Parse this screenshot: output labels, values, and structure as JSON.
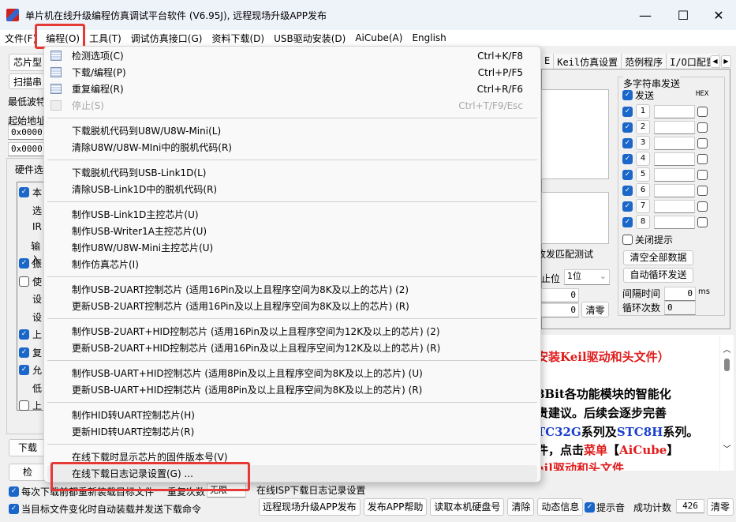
{
  "window": {
    "title": "单片机在线升级编程仿真调试平台软件 (V6.95J), 远程现场升级APP发布",
    "minimize": "—",
    "maximize": "☐",
    "close": "✕"
  },
  "menubar": [
    "文件(F)",
    "编程(O)",
    "工具(T)",
    "调试仿真接口(G)",
    "资料下载(D)",
    "USB驱动安装(D)",
    "AiCube(A)",
    "English"
  ],
  "left": {
    "chip_type": "芯片型",
    "scan": "扫描串",
    "min_baud": "最低波特",
    "start_addr": "起始地址",
    "addr1": "0x0000",
    "addr2": "0x0000",
    "hw_group": "硬件选",
    "opts": [
      {
        "label": "本",
        "checked": true
      },
      {
        "label": "选",
        "checked": null
      },
      {
        "label": "IR",
        "checked": null
      },
      {
        "label": "输入",
        "checked": null
      },
      {
        "label": "振",
        "checked": true
      },
      {
        "label": "使",
        "checked": false
      },
      {
        "label": "设",
        "checked": null
      },
      {
        "label": "设",
        "checked": null
      },
      {
        "label": "上",
        "checked": true
      },
      {
        "label": "复",
        "checked": true
      },
      {
        "label": "允",
        "checked": true
      },
      {
        "label": "低",
        "checked": null
      },
      {
        "label": "上",
        "checked": false
      }
    ],
    "download_btn": "下载",
    "check_btn": "检"
  },
  "tabs": [
    "E",
    "Keil仿真设置",
    "范例程序",
    "I/O口配置"
  ],
  "multi": {
    "title": "多字符串发送",
    "send": "发送",
    "hex": "HEX",
    "rows": [
      "1",
      "2",
      "3",
      "4",
      "5",
      "6",
      "7",
      "8"
    ],
    "close_tip": "关闭提示",
    "clear_all": "清空全部数据",
    "auto_loop": "自动循环发送",
    "interval_label": "间隔时间",
    "interval": "0",
    "interval_unit": "ms",
    "loop_label": "循环次数",
    "loop": "0"
  },
  "serial": {
    "match_test": "收发匹配测试",
    "stop_bits_label": "止位",
    "stop_bits": "1位",
    "count1": "0",
    "count2": "0",
    "clear": "清零"
  },
  "doc_lines": [
    [
      {
        "t": "安装Keil驱动和头文件）",
        "c": "red"
      }
    ],
    [
      {
        "t": "8Bit各功能模块的智能化",
        "c": ""
      }
    ],
    [
      {
        "t": "贵建议。后续会逐步完善",
        "c": ""
      }
    ],
    [
      {
        "t": "TC32G",
        "c": "blue"
      },
      {
        "t": "系列及",
        "c": ""
      },
      {
        "t": "STC8H",
        "c": "blue"
      },
      {
        "t": "系列。",
        "c": ""
      }
    ],
    [
      {
        "t": "件，点击",
        "c": ""
      },
      {
        "t": "菜单",
        "c": "red"
      },
      {
        "t": "【",
        "c": ""
      },
      {
        "t": "AiCube",
        "c": "red"
      },
      {
        "t": "】",
        "c": ""
      }
    ],
    [
      {
        "t": "eil驱动和头文件",
        "c": "red"
      }
    ]
  ],
  "menu": [
    {
      "label": "检测选项(C)",
      "shortcut": "Ctrl+K/F8",
      "icon": "check-options"
    },
    {
      "label": "下载/编程(P)",
      "shortcut": "Ctrl+P/F5",
      "icon": "download"
    },
    {
      "label": "重复编程(R)",
      "shortcut": "Ctrl+R/F6",
      "icon": "repeat-program"
    },
    {
      "label": "停止(S)",
      "shortcut": "Ctrl+T/F9/Esc",
      "icon": "stop",
      "disabled": true
    },
    {
      "sep": true
    },
    {
      "label": "下载脱机代码到U8W/U8W-Mini(L)"
    },
    {
      "label": "清除U8W/U8W-MIni中的脱机代码(R)"
    },
    {
      "sep": true
    },
    {
      "label": "下载脱机代码到USB-Link1D(L)"
    },
    {
      "label": "清除USB-Link1D中的脱机代码(R)"
    },
    {
      "sep": true
    },
    {
      "label": "制作USB-Link1D主控芯片(U)"
    },
    {
      "label": "制作USB-Writer1A主控芯片(U)"
    },
    {
      "label": "制作U8W/U8W-Mini主控芯片(U)"
    },
    {
      "label": "制作仿真芯片(I)"
    },
    {
      "sep": true
    },
    {
      "label": "制作USB-2UART控制芯片 (适用16Pin及以上且程序空间为8K及以上的芯片) (2)"
    },
    {
      "label": "更新USB-2UART控制芯片 (适用16Pin及以上且程序空间为8K及以上的芯片) (R)"
    },
    {
      "sep": true
    },
    {
      "label": "制作USB-2UART+HID控制芯片 (适用16Pin及以上且程序空间为12K及以上的芯片) (2)"
    },
    {
      "label": "更新USB-2UART+HID控制芯片 (适用16Pin及以上且程序空间为12K及以上的芯片) (R)"
    },
    {
      "sep": true
    },
    {
      "label": "制作USB-UART+HID控制芯片 (适用8Pin及以上且程序空间为8K及以上的芯片) (U)"
    },
    {
      "label": "更新USB-UART+HID控制芯片 (适用8Pin及以上且程序空间为8K及以上的芯片) (R)"
    },
    {
      "sep": true
    },
    {
      "label": "制作HID转UART控制芯片(H)"
    },
    {
      "label": "更新HID转UART控制芯片(R)"
    },
    {
      "sep": true
    },
    {
      "label": "在线下载时显示芯片的固件版本号(V)"
    },
    {
      "label": "在线下载日志记录设置(G) ...",
      "hover": true
    }
  ],
  "bottom": {
    "reload_each": "每次下载前都重新装载目标文件",
    "auto_reload": "当目标文件变化时自动装载并发送下载命令",
    "repeat_label": "重复次数",
    "repeat": "无限",
    "log_label": "在线ISP下载日志记录设置",
    "buttons": [
      "远程现场升级APP发布",
      "发布APP帮助",
      "读取本机硬盘号",
      "清除",
      "动态信息"
    ],
    "beep": "提示音",
    "success_label": "成功计数",
    "success": "426",
    "clear": "清零"
  },
  "colors": {
    "highlight": "#e53935",
    "accent": "#1a66c9"
  }
}
